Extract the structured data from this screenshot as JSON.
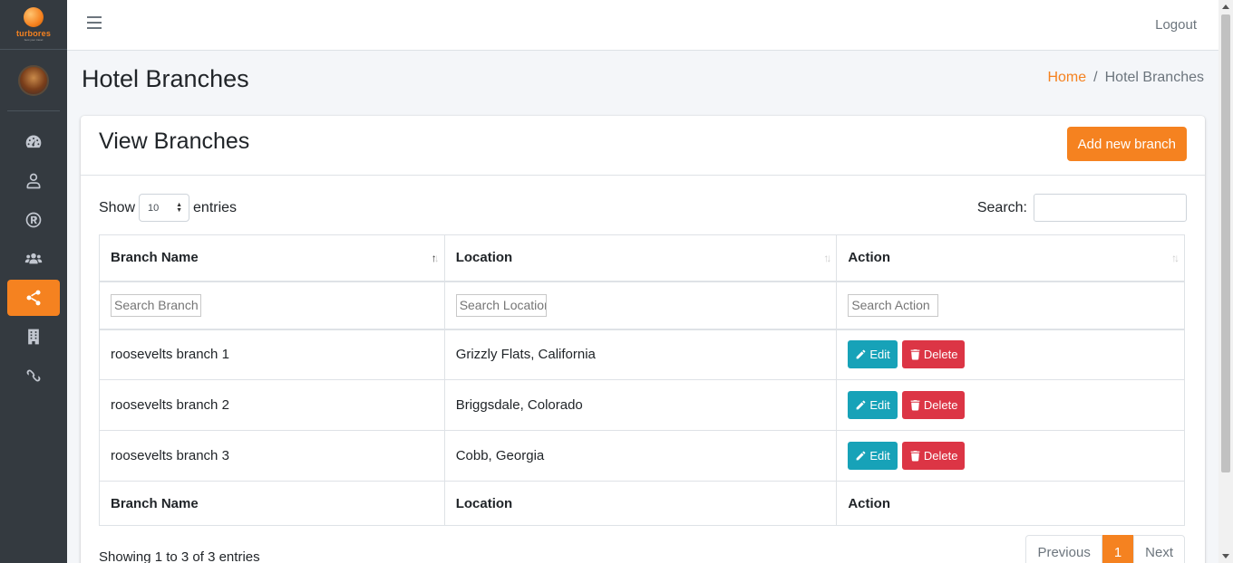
{
  "brand": {
    "name": "turbores",
    "tagline": "best your travel"
  },
  "nav": {
    "items": [
      {
        "icon": "dashboard-icon"
      },
      {
        "icon": "user-icon"
      },
      {
        "icon": "registered-icon"
      },
      {
        "icon": "users-icon"
      },
      {
        "icon": "share-icon",
        "active": true
      },
      {
        "icon": "building-icon"
      },
      {
        "icon": "link-icon"
      }
    ]
  },
  "topbar": {
    "logout_label": "Logout"
  },
  "page": {
    "title": "Hotel Branches"
  },
  "breadcrumb": {
    "home": "Home",
    "separator": "/",
    "current": "Hotel Branches"
  },
  "card": {
    "title": "View Branches",
    "add_button": "Add new branch"
  },
  "table_controls": {
    "show_label": "Show",
    "entries_value": "10",
    "entries_label": "entries",
    "search_label": "Search:"
  },
  "table": {
    "columns": [
      "Branch Name",
      "Location",
      "Action"
    ],
    "filters": [
      "Search Branch",
      "Search Location",
      "Search Action"
    ],
    "rows": [
      {
        "name": "roosevelts branch 1",
        "location": "Grizzly Flats, California"
      },
      {
        "name": "roosevelts branch 2",
        "location": "Briggsdale, Colorado"
      },
      {
        "name": "roosevelts branch 3",
        "location": "Cobb, Georgia"
      }
    ],
    "edit_label": "Edit",
    "delete_label": "Delete"
  },
  "footer": {
    "info": "Showing 1 to 3 of 3 entries",
    "previous": "Previous",
    "current_page": "1",
    "next": "Next"
  },
  "colors": {
    "accent": "#f58220",
    "sidebar": "#343a40",
    "edit": "#17a2b8",
    "delete": "#dc3545"
  }
}
